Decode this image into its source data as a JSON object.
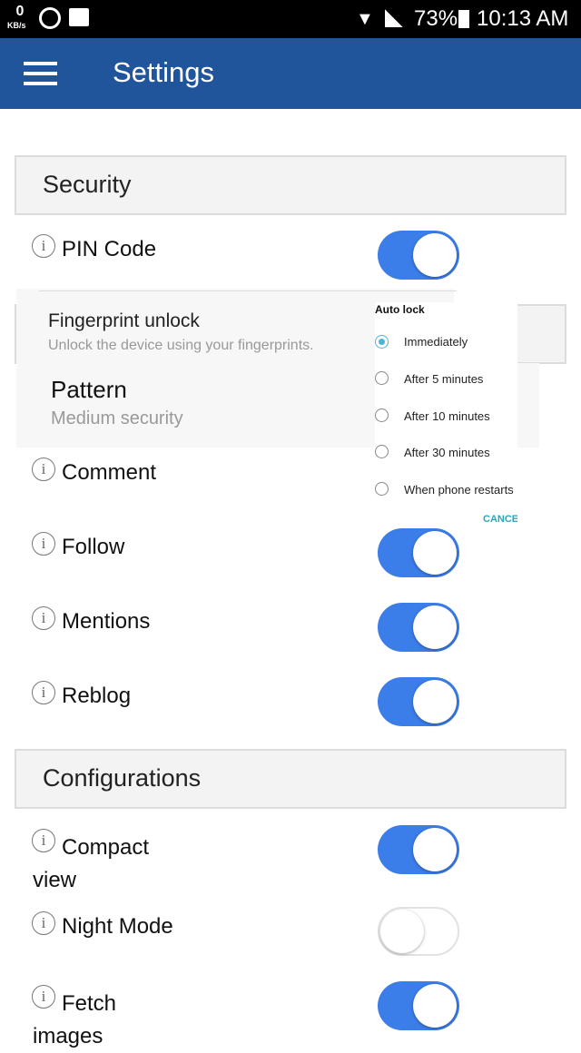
{
  "status_bar": {
    "speed_value": "0",
    "speed_unit": "KB/s",
    "battery": "73%",
    "time": "10:13 AM",
    "icons": [
      "whatsapp-icon",
      "gallery-icon",
      "wifi-icon",
      "signal-icon",
      "battery-icon"
    ]
  },
  "app_bar": {
    "title": "Settings",
    "menu_icon": "hamburger-icon"
  },
  "colors": {
    "app_bar": "#21559b",
    "toggle_on": "#3b7de9",
    "radio_on": "#4fb3d9",
    "cancel": "#2aa7b8"
  },
  "sections": [
    {
      "title": "Security",
      "items": [
        {
          "label": "PIN Code",
          "on": true
        },
        {
          "label": "Comment",
          "on": true
        },
        {
          "label": "Follow",
          "on": true
        },
        {
          "label": "Mentions",
          "on": true
        },
        {
          "label": "Reblog",
          "on": true
        }
      ]
    },
    {
      "title": "Configurations",
      "items": [
        {
          "label": "Compact view",
          "on": true
        },
        {
          "label": "Night Mode",
          "on": false
        },
        {
          "label": "Fetch images",
          "on": true
        }
      ]
    }
  ],
  "overlay": {
    "fingerprint_title": "Fingerprint unlock",
    "fingerprint_sub": "Unlock the device using your fingerprints.",
    "pattern_title": "Pattern",
    "pattern_sub": "Medium security"
  },
  "dialog": {
    "title": "Auto lock",
    "options": [
      "Immediately",
      "After 5 minutes",
      "After 10 minutes",
      "After 30 minutes",
      "When phone restarts"
    ],
    "selected": "Immediately",
    "cancel": "CANCEL"
  }
}
